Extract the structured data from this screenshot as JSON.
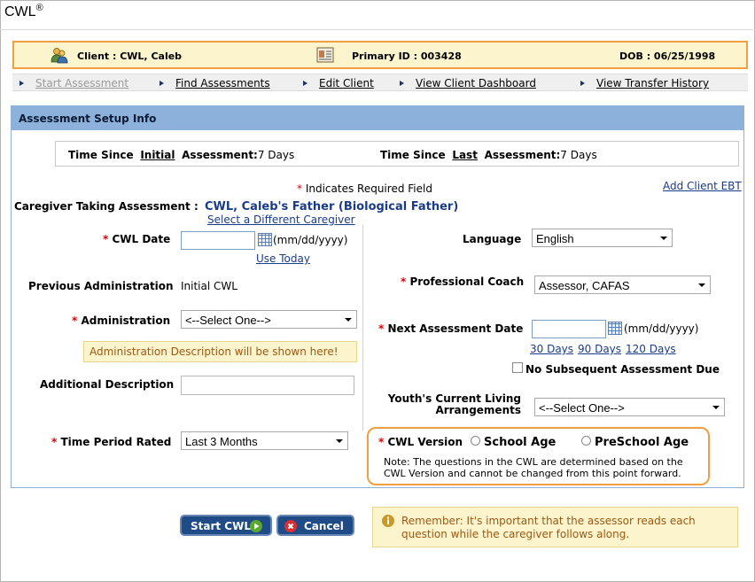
{
  "window": {
    "title": "CWL",
    "title_mark": "®"
  },
  "client_bar": {
    "client": "Client : CWL, Caleb",
    "primary_id": "Primary ID : 003428",
    "dob": "DOB : 06/25/1998"
  },
  "nav": [
    {
      "label": "Start Assessment"
    },
    {
      "label": "Find Assessments"
    },
    {
      "label": "Edit Client"
    },
    {
      "label": "View Client Dashboard"
    },
    {
      "label": "View Transfer History"
    }
  ],
  "panel": {
    "title": "Assessment Setup Info",
    "time_since_initial": {
      "pre": "Time Since",
      "link": "Initial",
      "post": "Assessment:",
      "value": "7 Days"
    },
    "time_since_last": {
      "pre": "Time Since",
      "link": "Last",
      "post": "Assessment:",
      "value": "7 Days"
    },
    "required_note": "Indicates Required Field",
    "add_client_ebt": "Add Client EBT",
    "caregiver_label": "Caregiver Taking Assessment :",
    "caregiver_value": "CWL, Caleb's Father (Biological Father)",
    "select_caregiver": "Select a Different Caregiver",
    "cwl_date_label": "CWL Date",
    "date_format": "(mm/dd/yyyy)",
    "use_today": "Use Today",
    "previous_admin_label": "Previous Administration",
    "previous_admin_value": "Initial CWL",
    "administration_label": "Administration",
    "administration_value": "<--Select One-->",
    "admin_description": "Administration Description will be shown here!",
    "additional_description_label": "Additional Description",
    "time_period_label": "Time Period Rated",
    "time_period_value": "Last 3 Months",
    "language_label": "Language",
    "language_value": "English",
    "professional_coach_label": "Professional Coach",
    "professional_coach_value": "Assessor, CAFAS",
    "next_assessment_label": "Next Assessment Date",
    "next_date_format": "(mm/dd/yyyy)",
    "days_30": "30 Days",
    "days_90": "90 Days",
    "days_120": "120 Days",
    "no_subsequent": "No Subsequent Assessment Due",
    "living_label_1": "Youth's Current Living",
    "living_label_2": "Arrangements",
    "living_value": "<--Select One-->",
    "cwl_version_label": "CWL Version",
    "option_school_age": "School Age",
    "option_preschool_age": "PreSchool Age",
    "version_note_1": "Note: The questions in the CWL are determined based on the",
    "version_note_2": "CWL Version and cannot be changed from this point forward."
  },
  "actions": {
    "start": "Start CWL",
    "cancel": "Cancel",
    "reminder_1": "Remember: It's important that the assessor reads each",
    "reminder_2": "question while the caregiver follows along."
  },
  "colors": {
    "header_blue": "#8cb2dc",
    "highlight_orange": "#f0a040",
    "note_yellow": "#fbf4cc",
    "link_blue": "#1a3c88"
  },
  "required_marker": "*"
}
